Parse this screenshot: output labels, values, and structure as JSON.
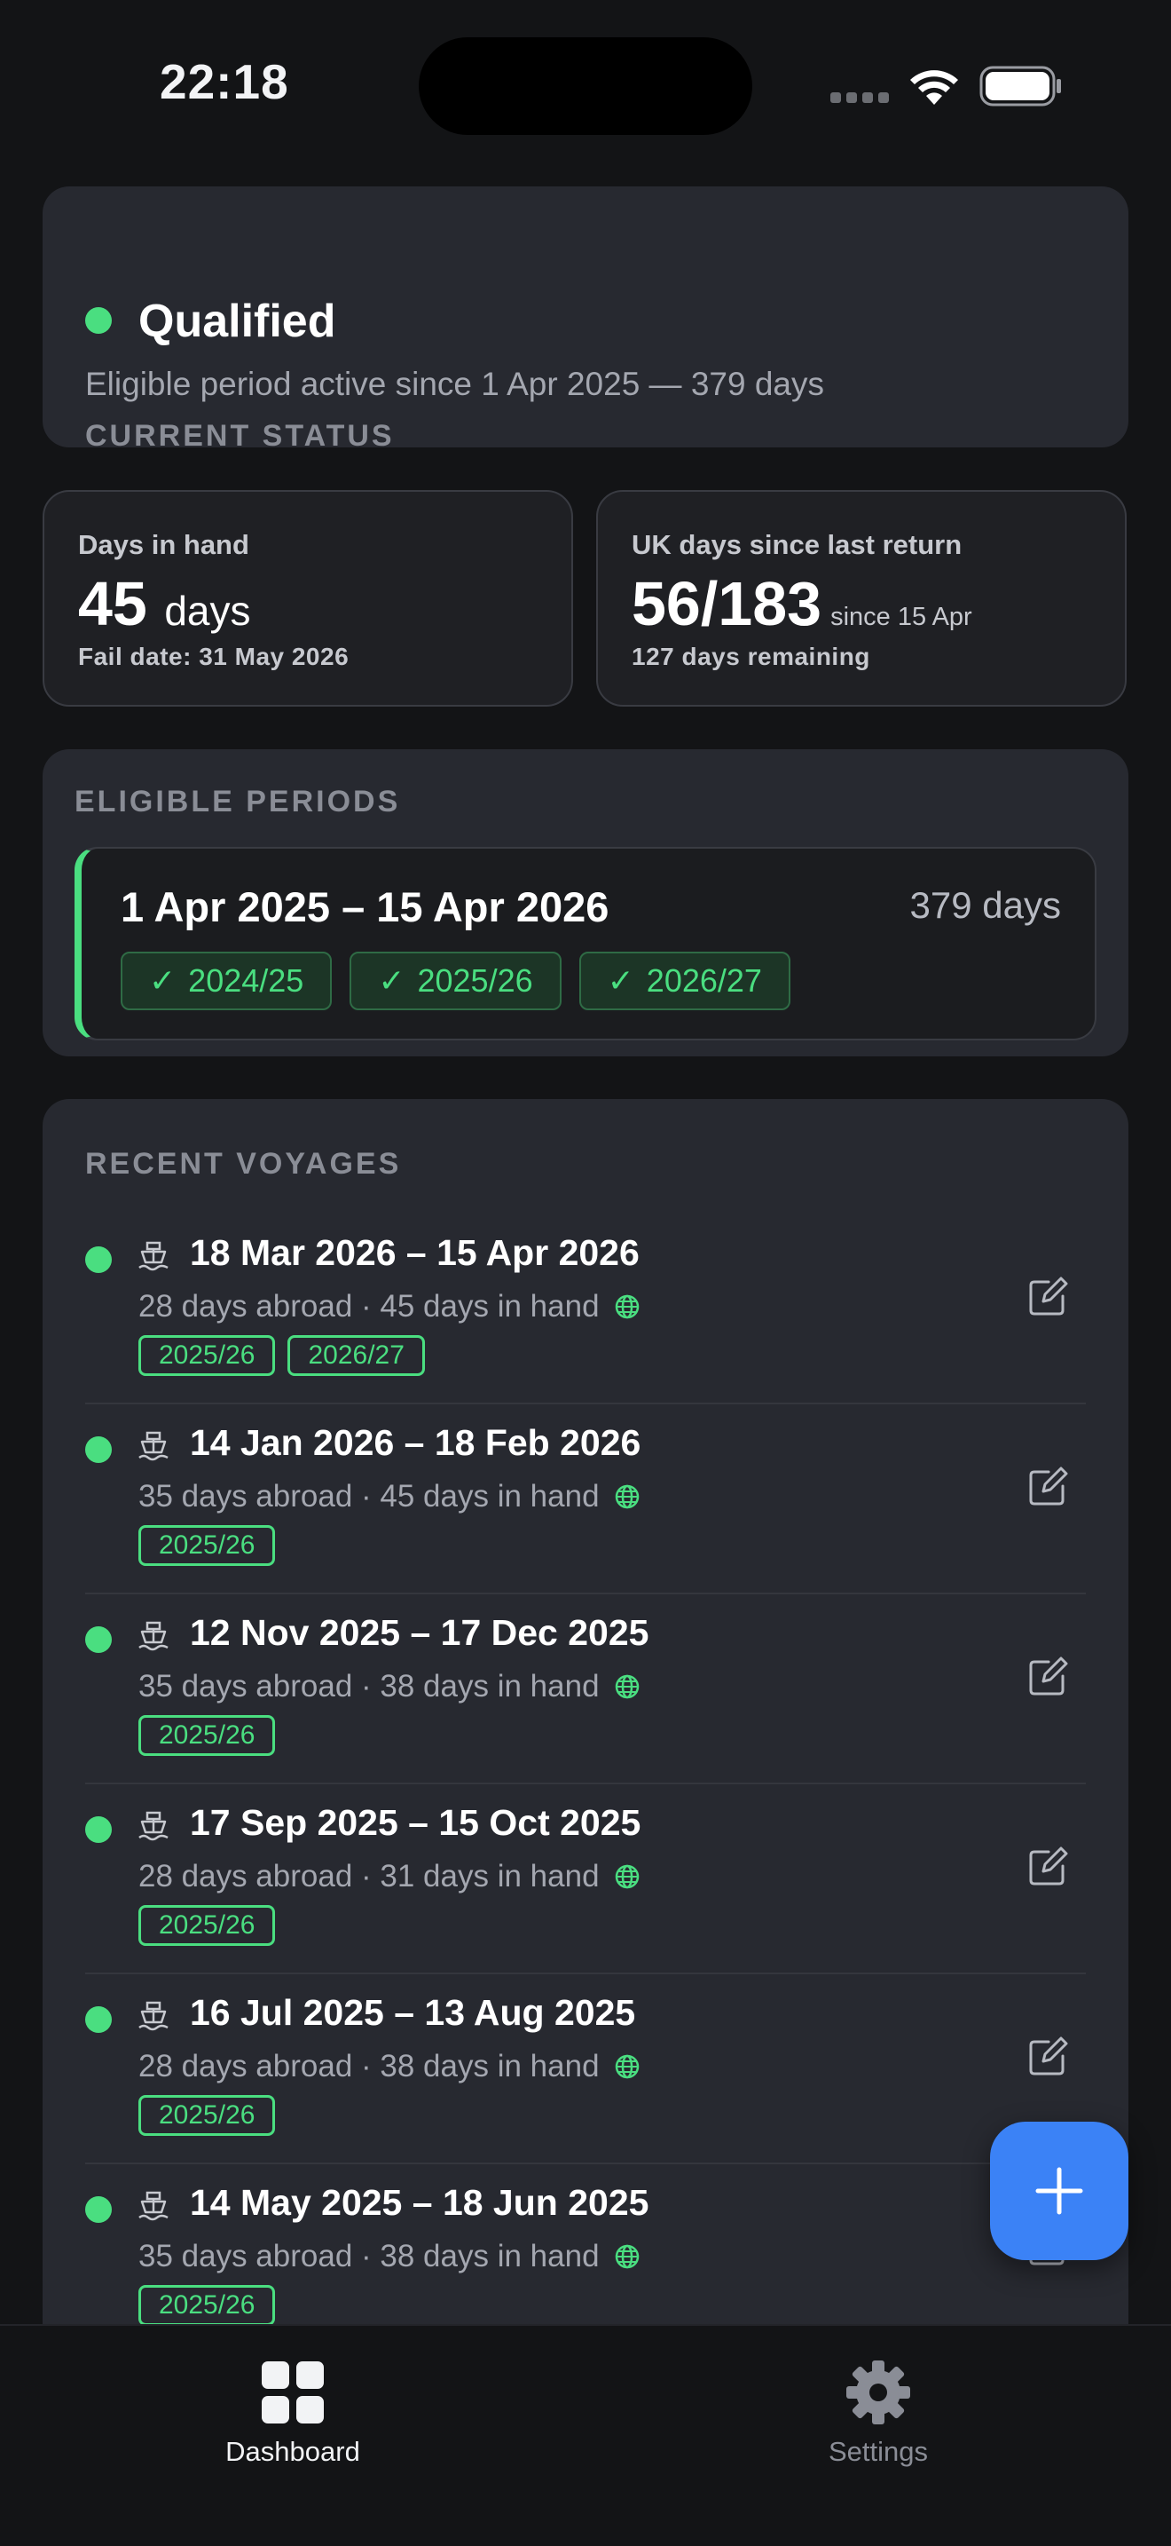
{
  "status_bar": {
    "time": "22:18"
  },
  "current_status": {
    "label": "Current Status",
    "title": "Qualified",
    "description": "Eligible period active since 1 Apr 2025 — 379 days",
    "color": "#4ade80"
  },
  "stats": {
    "days_in_hand": {
      "label": "Days in hand",
      "value": "45",
      "unit": "days",
      "sub": "Fail date: 31 May 2026"
    },
    "uk_days": {
      "label": "UK days since last return",
      "value": "56/183",
      "suffix": "since 15 Apr",
      "sub": "127 days remaining"
    }
  },
  "eligible_periods": {
    "label": "Eligible Periods",
    "items": [
      {
        "range": "1 Apr 2025 – 15 Apr 2026",
        "days": "379 days",
        "tags": [
          "2024/25",
          "2025/26",
          "2026/27"
        ]
      }
    ]
  },
  "voyages": {
    "label": "Recent Voyages",
    "items": [
      {
        "title": "18 Mar 2026 – 15 Apr 2026",
        "sub": "28 days abroad · 45 days in hand",
        "tags": [
          "2025/26",
          "2026/27"
        ]
      },
      {
        "title": "14 Jan 2026 – 18 Feb 2026",
        "sub": "35 days abroad · 45 days in hand",
        "tags": [
          "2025/26"
        ]
      },
      {
        "title": "12 Nov 2025 – 17 Dec 2025",
        "sub": "35 days abroad · 38 days in hand",
        "tags": [
          "2025/26"
        ]
      },
      {
        "title": "17 Sep 2025 – 15 Oct 2025",
        "sub": "28 days abroad · 31 days in hand",
        "tags": [
          "2025/26"
        ]
      },
      {
        "title": "16 Jul 2025 – 13 Aug 2025",
        "sub": "28 days abroad · 38 days in hand",
        "tags": [
          "2025/26"
        ]
      },
      {
        "title": "14 May 2025 – 18 Jun 2025",
        "sub": "35 days abroad · 38 days in hand",
        "tags": [
          "2025/26"
        ]
      }
    ]
  },
  "tabs": [
    {
      "label": "Dashboard",
      "icon": "grid-icon",
      "active": true
    },
    {
      "label": "Settings",
      "icon": "gear-icon",
      "active": false
    }
  ],
  "colors": {
    "accent": "#4ade80",
    "fab": "#3b82f6",
    "background": "#131416",
    "card": "#272930"
  }
}
